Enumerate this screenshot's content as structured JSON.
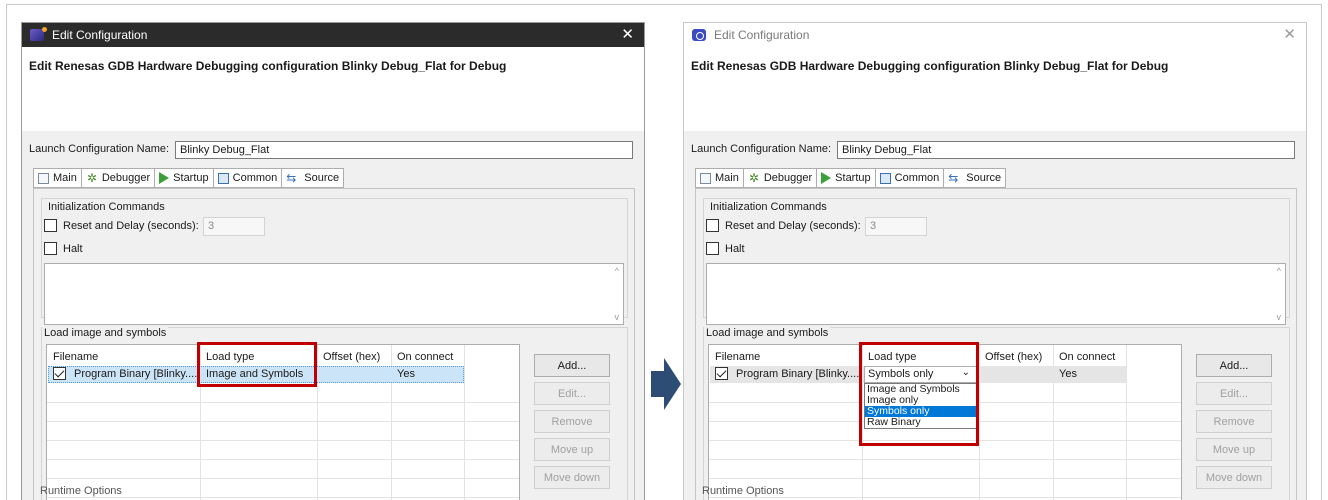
{
  "left": {
    "window_title": "Edit Configuration",
    "header_title": "Edit Renesas GDB Hardware Debugging configuration Blinky Debug_Flat for Debug",
    "launch_label": "Launch Configuration Name:",
    "launch_value": "Blinky Debug_Flat",
    "tabs": [
      "Main",
      "Debugger",
      "Startup",
      "Common",
      "Source"
    ],
    "init_group": "Initialization Commands",
    "reset_label": "Reset and Delay (seconds):",
    "reset_value": "3",
    "halt_label": "Halt",
    "load_group": "Load image and symbols",
    "columns": [
      "Filename",
      "Load type",
      "Offset (hex)",
      "On connect"
    ],
    "row": {
      "filename": "Program Binary [Blinky....",
      "load_type": "Image and Symbols",
      "offset": "",
      "on_connect": "Yes"
    },
    "buttons": {
      "add": "Add...",
      "edit": "Edit...",
      "remove": "Remove",
      "move_up": "Move up",
      "move_down": "Move down"
    },
    "cutoff_text": "Runtime Options"
  },
  "right": {
    "window_title": "Edit Configuration",
    "header_title": "Edit Renesas GDB Hardware Debugging configuration Blinky Debug_Flat for Debug",
    "launch_label": "Launch Configuration Name:",
    "launch_value": "Blinky Debug_Flat",
    "tabs": [
      "Main",
      "Debugger",
      "Startup",
      "Common",
      "Source"
    ],
    "init_group": "Initialization Commands",
    "reset_label": "Reset and Delay (seconds):",
    "reset_value": "3",
    "halt_label": "Halt",
    "load_group": "Load image and symbols",
    "columns": [
      "Filename",
      "Load type",
      "Offset (hex)",
      "On connect"
    ],
    "row": {
      "filename": "Program Binary [Blinky....",
      "load_type": "Symbols only",
      "offset": "",
      "on_connect": "Yes"
    },
    "dropdown_options": [
      "Image and Symbols",
      "Image only",
      "Symbols only",
      "Raw Binary"
    ],
    "dropdown_selected": "Symbols only",
    "buttons": {
      "add": "Add...",
      "edit": "Edit...",
      "remove": "Remove",
      "move_up": "Move up",
      "move_down": "Move down"
    },
    "cutoff_text": "Runtime Options"
  },
  "colors": {
    "highlight_box": "#c00000",
    "arrow": "#2e4d75",
    "selection": "#0078d7"
  }
}
